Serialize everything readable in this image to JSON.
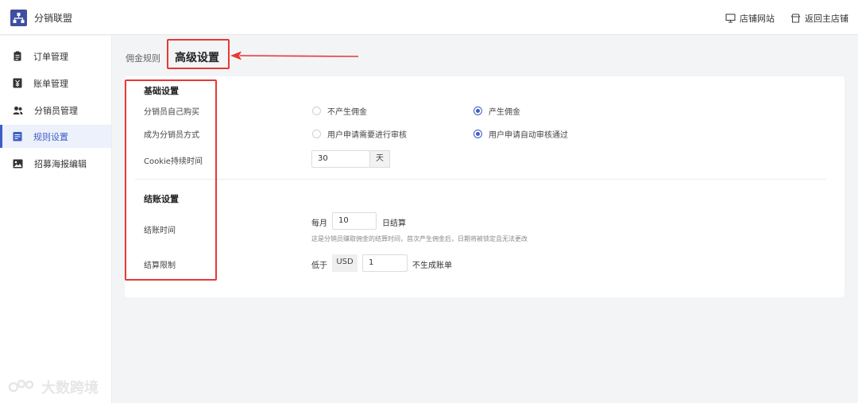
{
  "app": {
    "title": "分销联盟"
  },
  "header": {
    "store_site_label": "店铺网站",
    "back_label": "返回主店铺"
  },
  "sidebar": {
    "items": [
      {
        "label": "订单管理",
        "icon": "clipboard-icon"
      },
      {
        "label": "账单管理",
        "icon": "yen-icon"
      },
      {
        "label": "分销员管理",
        "icon": "users-icon"
      },
      {
        "label": "规则设置",
        "icon": "rules-icon",
        "active": true
      },
      {
        "label": "招募海报编辑",
        "icon": "image-icon"
      }
    ]
  },
  "tabs": {
    "commission_rules": "佣金规则",
    "advanced_settings": "高级设置"
  },
  "basic": {
    "title": "基础设置",
    "self_purchase": {
      "label": "分销员自己购买",
      "options": [
        "不产生佣金",
        "产生佣金"
      ],
      "selected": 1
    },
    "become_method": {
      "label": "成为分销员方式",
      "options": [
        "用户申请需要进行审核",
        "用户申请自动审核通过"
      ],
      "selected": 1
    },
    "cookie": {
      "label": "Cookie持续时间",
      "value": "30",
      "unit": "天"
    }
  },
  "settlement": {
    "title": "结账设置",
    "time": {
      "label": "结账时间",
      "prefix": "每月",
      "value": "10",
      "suffix": "日结算",
      "hint": "这是分销员赚取佣金的结算时间，首次产生佣金后，日期将被锁定且无法更改"
    },
    "limit": {
      "label": "结算限制",
      "prefix": "低于",
      "currency": "USD",
      "value": "1",
      "suffix": "不生成账单"
    }
  },
  "watermark": {
    "text": "大数跨境"
  },
  "colors": {
    "accent": "#3d5dc7",
    "highlight": "#e53935",
    "logo": "#3e4fa3"
  }
}
